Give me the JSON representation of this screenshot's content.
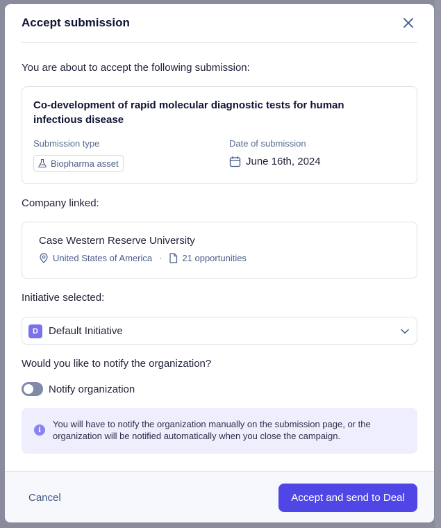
{
  "modal": {
    "title": "Accept submission",
    "intro": "You are about to accept the following submission:"
  },
  "submission": {
    "title": "Co-development of rapid molecular diagnostic tests for human infectious disease",
    "type_label": "Submission type",
    "type_value": "Biopharma asset",
    "type_icon": "flask-icon",
    "date_label": "Date of submission",
    "date_value": "June 16th, 2024",
    "date_icon": "calendar-icon"
  },
  "company": {
    "section_label": "Company linked:",
    "name": "Case Western Reserve University",
    "location": "United States of America",
    "location_icon": "map-pin-icon",
    "separator": "·",
    "opportunities": "21 opportunities",
    "opportunities_icon": "file-icon"
  },
  "initiative": {
    "section_label": "Initiative selected:",
    "badge": "D",
    "selected": "Default Initiative",
    "chevron_icon": "chevron-down-icon"
  },
  "notify": {
    "question": "Would you like to notify the organization?",
    "toggle_label": "Notify organization",
    "toggle_on": false,
    "info_icon": "info-icon",
    "info_symbol": "i",
    "info_text": "You will have to notify the organization manually on the submission page, or the organization will be notified automatically when you close the campaign."
  },
  "footer": {
    "cancel_label": "Cancel",
    "primary_label": "Accept and send to Deal"
  },
  "colors": {
    "primary": "#4f46e5",
    "badge": "#7b72e9",
    "info_bg": "#eeeefc",
    "title_text": "#0f1333",
    "muted_text": "#5a6b93"
  }
}
